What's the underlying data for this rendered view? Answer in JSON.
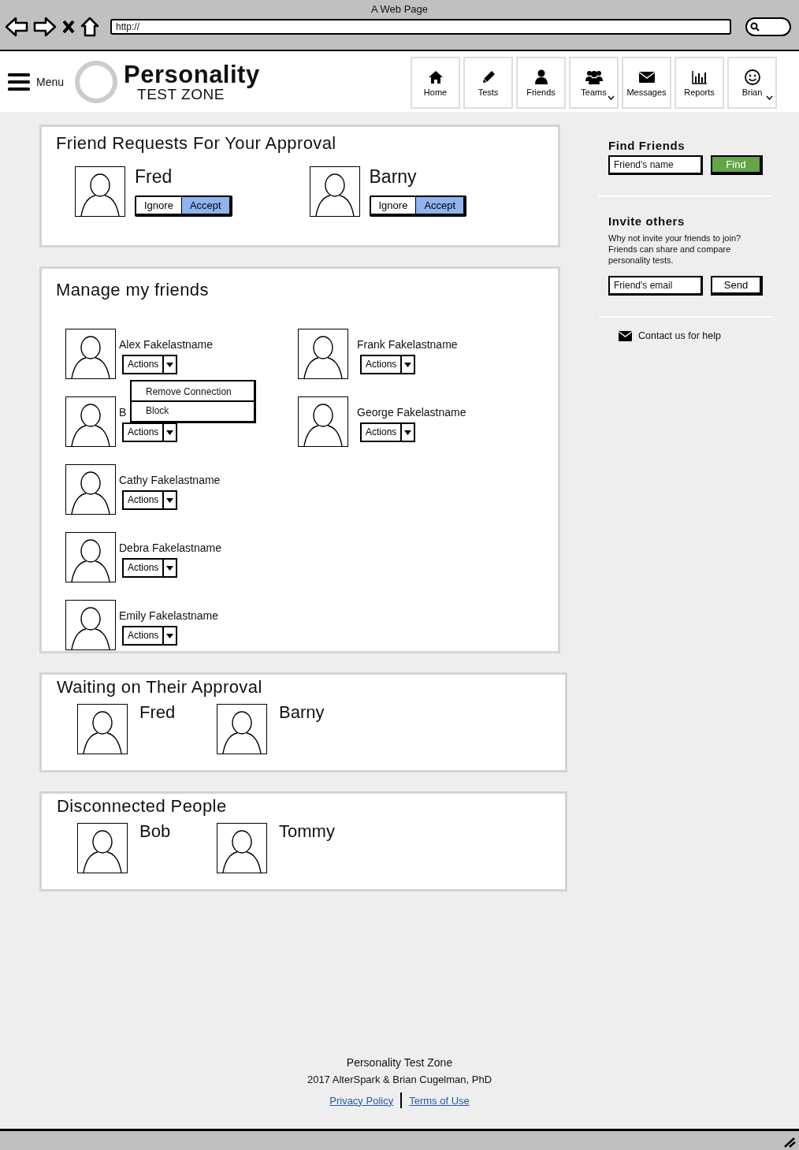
{
  "browser": {
    "title": "A Web Page",
    "url": "http://"
  },
  "header": {
    "menu_label": "Menu",
    "logo_title": "Personality",
    "logo_subtitle": "TEST ZONE",
    "nav": [
      {
        "label": "Home",
        "dropdown": false
      },
      {
        "label": "Tests",
        "dropdown": false
      },
      {
        "label": "Friends",
        "dropdown": false
      },
      {
        "label": "Teams",
        "dropdown": true
      },
      {
        "label": "Messages",
        "dropdown": false
      },
      {
        "label": "Reports",
        "dropdown": false
      },
      {
        "label": "Brian",
        "dropdown": true
      }
    ]
  },
  "friend_requests": {
    "title": "Friend Requests For Your Approval",
    "people": [
      {
        "name": "Fred",
        "ignore_label": "Ignore",
        "accept_label": "Accept"
      },
      {
        "name": "Barny",
        "ignore_label": "Ignore",
        "accept_label": "Accept"
      }
    ]
  },
  "manage": {
    "title": "Manage my friends",
    "columns": [
      [
        {
          "name": "Alex Fakelastname",
          "action_label": "Actions",
          "menu": [
            "Remove Connection",
            "Block"
          ]
        },
        {
          "name": "B",
          "action_label": "Actions"
        },
        {
          "name": "Cathy Fakelastname",
          "action_label": "Actions"
        },
        {
          "name": "Debra Fakelastname",
          "action_label": "Actions"
        },
        {
          "name": "Emily Fakelastname",
          "action_label": "Actions"
        }
      ],
      [
        {
          "name": "Frank Fakelastname",
          "action_label": "Actions"
        },
        {
          "name": "George Fakelastname",
          "action_label": "Actions"
        }
      ]
    ]
  },
  "waiting": {
    "title": "Waiting on Their Approval",
    "people": [
      {
        "name": "Fred"
      },
      {
        "name": "Barny"
      }
    ]
  },
  "disconnected": {
    "title": "Disconnected People",
    "people": [
      {
        "name": "Bob"
      },
      {
        "name": "Tommy"
      }
    ]
  },
  "sidebar": {
    "find": {
      "title": "Find Friends",
      "placeholder": "Friend's name",
      "button": "Find"
    },
    "invite": {
      "title": "Invite others",
      "text": "Why not invite your friends to join? Friends can share and compare personality tests.",
      "placeholder": "Friend's email",
      "button": "Send"
    },
    "contact": "Contact us for help"
  },
  "footer": {
    "title": "Personality Test Zone",
    "copyright": "2017 AlterSpark & Brian Cugelman, PhD",
    "links": [
      "Privacy Policy",
      "Terms of Use"
    ]
  }
}
